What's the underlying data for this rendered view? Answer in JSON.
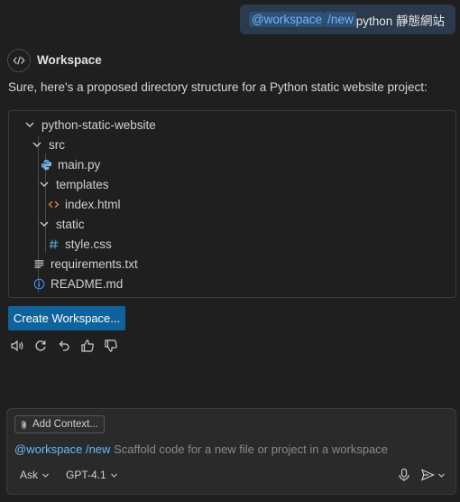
{
  "user_message": {
    "agent_chip": "@workspace",
    "command_chip": "/new",
    "text": "python 靜態網站"
  },
  "agent": {
    "name": "Workspace",
    "response": "Sure, here's a proposed directory structure for a Python static website project:"
  },
  "tree": {
    "root": "python-static-website",
    "src": "src",
    "main_py": "main.py",
    "templates": "templates",
    "index_html": "index.html",
    "static": "static",
    "style_css": "style.css",
    "requirements": "requirements.txt",
    "readme": "README.md"
  },
  "create_button": "Create Workspace...",
  "input": {
    "add_context": "Add Context...",
    "agent_chip": "@workspace",
    "command_chip": "/new",
    "placeholder": "Scaffold code for a new file or project in a workspace",
    "mode": "Ask",
    "model": "GPT-4.1"
  },
  "colors": {
    "background": "#1f1f1f",
    "accent_button": "#0e639c",
    "chip_text": "#6cb6ff",
    "python_icon": "#5b9bd5",
    "html_icon": "#e37933",
    "css_icon": "#519aba",
    "info_icon": "#3794ff"
  },
  "icons": [
    "code-icon",
    "chevron-down-icon",
    "python-file-icon",
    "html-file-icon",
    "css-file-icon",
    "text-file-icon",
    "info-icon",
    "speaker-icon",
    "retry-icon",
    "undo-icon",
    "thumbs-up-icon",
    "thumbs-down-icon",
    "paperclip-icon",
    "mic-icon",
    "send-icon"
  ]
}
